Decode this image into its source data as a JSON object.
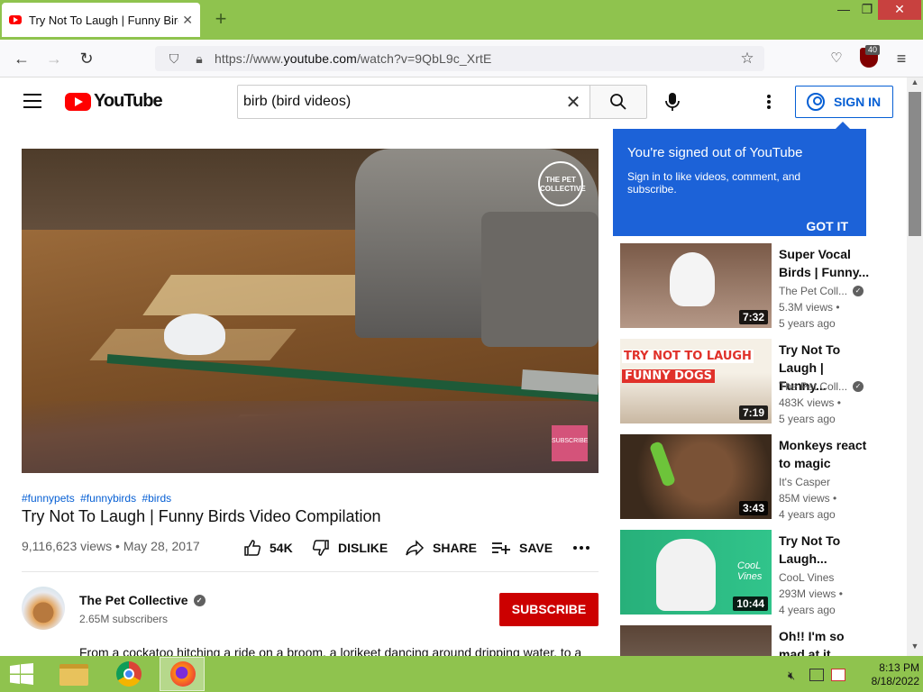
{
  "browser": {
    "tab_title": "Try Not To Laugh | Funny Birds Video Compilation",
    "url_prefix": "https://www.",
    "url_domain": "youtube.com",
    "url_path": "/watch?v=9QbL9c_XrtE",
    "extension_badge": "40"
  },
  "header": {
    "logo_text": "YouTube",
    "search_value": "birb (bird videos)",
    "sign_in_label": "SIGN IN"
  },
  "tooltip": {
    "title": "You're signed out of YouTube",
    "body": "Sign in to like videos, comment, and subscribe.",
    "button": "GOT IT"
  },
  "player": {
    "watermark": "THE PET COLLECTIVE",
    "subscribe_watermark": "SUBSCRIBE"
  },
  "video": {
    "hashtags": [
      "#funnypets",
      "#funnybirds",
      "#birds"
    ],
    "title": "Try Not To Laugh | Funny Birds Video Compilation",
    "meta": "9,116,623 views • May 28, 2017",
    "actions": {
      "like": "54K",
      "dislike": "DISLIKE",
      "share": "SHARE",
      "save": "SAVE"
    },
    "channel_name": "The Pet Collective",
    "subscribers": "2.65M subscribers",
    "subscribe_label": "SUBSCRIBE",
    "description": "From a cockatoo hitching a ride on a broom, a lorikeet dancing around dripping water, to a"
  },
  "recommendations": [
    {
      "title": "Super Vocal Birds | Funny...",
      "channel": "The Pet Coll...",
      "verified": true,
      "views": "5.3M views •",
      "age": "5 years ago",
      "duration": "7:32"
    },
    {
      "title": "Try Not To Laugh | Funny...",
      "channel": "The Pet Coll...",
      "verified": true,
      "views": "483K views •",
      "age": "5 years ago",
      "duration": "7:19",
      "thumb_text_1": "TRY NOT TO LAUGH",
      "thumb_text_2": "FUNNY DOGS"
    },
    {
      "title": "Monkeys react to magic",
      "channel": "It's Casper",
      "verified": false,
      "views": "85M views •",
      "age": "4 years ago",
      "duration": "3:43"
    },
    {
      "title": "Try Not To Laugh...",
      "channel": "CooL Vines",
      "verified": false,
      "views": "293M views •",
      "age": "4 years ago",
      "duration": "10:44",
      "thumb_text_1": "CooL Vines"
    },
    {
      "title": "Oh!! I'm so mad at it mom!!",
      "channel": "",
      "verified": false,
      "views": "",
      "age": "",
      "duration": ""
    }
  ],
  "taskbar": {
    "time": "8:13 PM",
    "date": "8/18/2022"
  }
}
